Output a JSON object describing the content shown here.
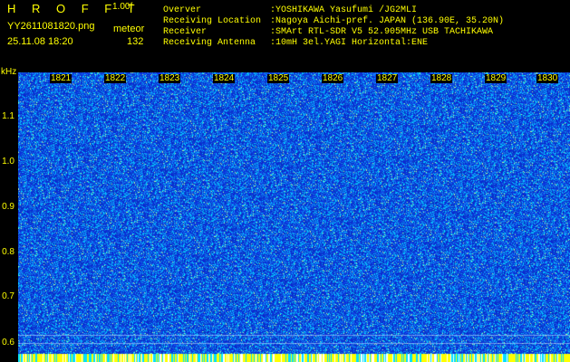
{
  "header": {
    "app_title": "H R O F F T",
    "version": "1.00f",
    "filename": "YY2611081820.png",
    "mode": "meteor",
    "datetime": "25.11.08 18:20",
    "count": "132"
  },
  "info": [
    {
      "label": "Overver",
      "value": ":YOSHIKAWA Yasufumi /JG2MLI"
    },
    {
      "label": "Receiving Location",
      "value": ":Nagoya Aichi-pref. JAPAN (136.90E, 35.20N)"
    },
    {
      "label": "Receiver",
      "value": ":SMArt RTL-SDR V5 52.905MHz USB TACHIKAWA"
    },
    {
      "label": "Receiving Antenna",
      "value": ":10mH 3el.YAGI Horizontal:ENE"
    }
  ],
  "axes": {
    "y_unit": "kHz",
    "y_ticks": [
      "1.1",
      "1.0",
      "0.9",
      "0.8",
      "0.7",
      "0.6"
    ],
    "x_ticks": [
      "1821",
      "1822",
      "1823",
      "1824",
      "1825",
      "1826",
      "1827",
      "1828",
      "1829",
      "1830"
    ]
  },
  "colors": {
    "text": "#ffff00",
    "background": "#000000",
    "noise_base": "#0a1fd0",
    "noise_mid": "#1e6bff",
    "noise_high": "#00e0ff"
  }
}
